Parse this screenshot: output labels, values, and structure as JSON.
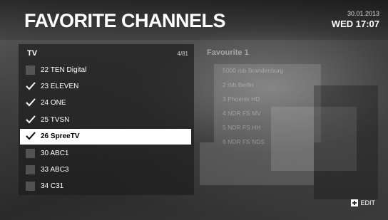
{
  "header": {
    "title": "FAVORITE CHANNELS",
    "date": "30.01.2013",
    "day_time": "WED 17:07"
  },
  "channel_list": {
    "header": "TV",
    "count": "4/81",
    "items": [
      {
        "label": "22 TEN Digital",
        "checked": false,
        "selected": false
      },
      {
        "label": "23 ELEVEN",
        "checked": true,
        "selected": false
      },
      {
        "label": "24 ONE",
        "checked": true,
        "selected": false
      },
      {
        "label": "25 TVSN",
        "checked": true,
        "selected": false
      },
      {
        "label": "26 SpreeTV",
        "checked": true,
        "selected": true
      },
      {
        "label": "30 ABC1",
        "checked": false,
        "selected": false
      },
      {
        "label": "33 ABC3",
        "checked": false,
        "selected": false
      },
      {
        "label": "34 C31",
        "checked": false,
        "selected": false
      }
    ]
  },
  "favourites": {
    "title": "Favourite 1",
    "items": [
      "5000 rbb Brandenburg",
      "2 rbb Berlin",
      "3 Phoenix HD",
      "4 NDR FS MV",
      "5 NDR FS HH",
      "6 NDR FS NDS"
    ]
  },
  "footer": {
    "edit_label": "EDIT",
    "edit_icon": "plus-box-icon"
  },
  "colors": {
    "selected_row_bg": "#ffffff",
    "panel_bg": "rgba(30,30,30,0.72)"
  }
}
